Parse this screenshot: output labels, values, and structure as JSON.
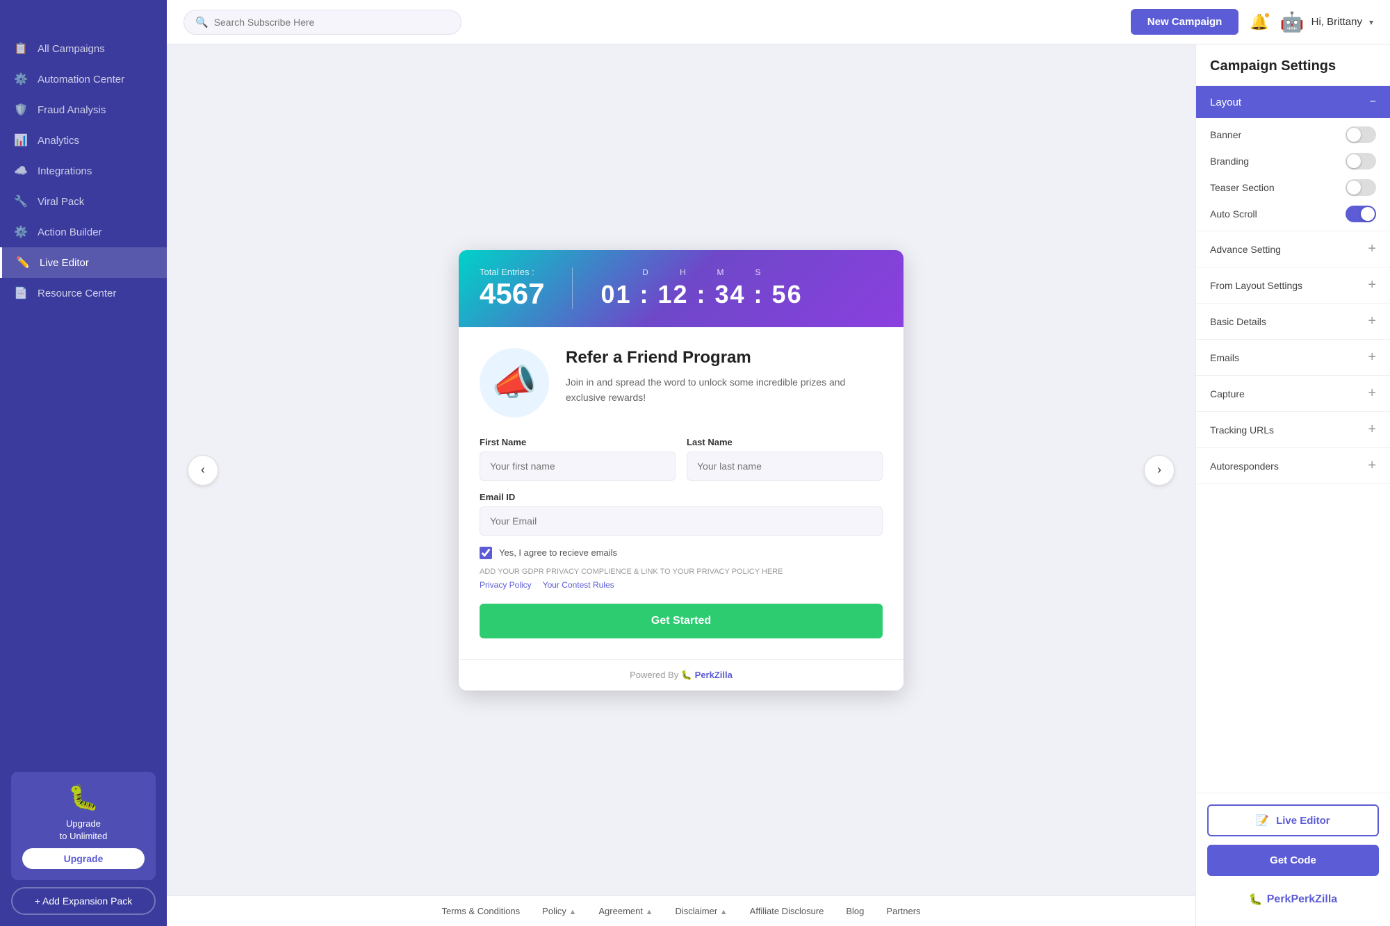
{
  "sidebar": {
    "items": [
      {
        "id": "all-campaigns",
        "label": "All Campaigns",
        "icon": "📋",
        "active": false
      },
      {
        "id": "automation-center",
        "label": "Automation Center",
        "icon": "⚙️",
        "active": false
      },
      {
        "id": "fraud-analysis",
        "label": "Fraud Analysis",
        "icon": "🛡️",
        "active": false
      },
      {
        "id": "analytics",
        "label": "Analytics",
        "icon": "📊",
        "active": false
      },
      {
        "id": "integrations",
        "label": "Integrations",
        "icon": "☁️",
        "active": false
      },
      {
        "id": "viral-pack",
        "label": "Viral Pack",
        "icon": "🔧",
        "active": false
      },
      {
        "id": "action-builder",
        "label": "Action Builder",
        "icon": "⚙️",
        "active": false
      },
      {
        "id": "live-editor",
        "label": "Live Editor",
        "icon": "✏️",
        "active": true
      },
      {
        "id": "resource-center",
        "label": "Resource Center",
        "icon": "📄",
        "active": false
      }
    ],
    "upgrade": {
      "text": "Upgrade\nto Unlimited",
      "button_label": "Upgrade"
    },
    "add_expansion": "+ Add Expansion Pack"
  },
  "topbar": {
    "search_placeholder": "Search Subscribe Here",
    "new_campaign_label": "New Campaign",
    "user_name": "Hi, Brittany"
  },
  "campaign": {
    "total_entries_label": "Total Entries :",
    "total_entries_value": "4567",
    "countdown": {
      "d_label": "D",
      "h_label": "H",
      "m_label": "M",
      "s_label": "S",
      "time": "01 : 12 : 34 : 56"
    },
    "title": "Refer a Friend Program",
    "description": "Join in and spread the word to unlock some incredible prizes and exclusive rewards!",
    "form": {
      "first_name_label": "First Name",
      "first_name_placeholder": "Your first name",
      "last_name_label": "Last Name",
      "last_name_placeholder": "Your last name",
      "email_label": "Email ID",
      "email_placeholder": "Your Email",
      "checkbox_label": "Yes, I agree to recieve emails",
      "gdpr_text": "ADD YOUR GDPR PRIVACY COMPLIENCE & LINK TO YOUR PRIVACY POLICY HERE",
      "privacy_policy_link": "Privacy Policy",
      "contest_rules_link": "Your Contest Rules",
      "submit_button": "Get Started"
    },
    "powered_by": "Powered By",
    "brand": "PerkZilla"
  },
  "footer": {
    "links": [
      {
        "label": "Terms & Conditions"
      },
      {
        "label": "Policy",
        "has_arrow": true
      },
      {
        "label": "Agreement",
        "has_arrow": true
      },
      {
        "label": "Disclaimer",
        "has_arrow": true
      },
      {
        "label": "Affiliate Disclosure"
      },
      {
        "label": "Blog"
      },
      {
        "label": "Partners"
      }
    ]
  },
  "right_panel": {
    "title": "Campaign Settings",
    "layout_section": {
      "label": "Layout",
      "active": true
    },
    "toggles": [
      {
        "id": "banner",
        "label": "Banner",
        "on": false
      },
      {
        "id": "branding",
        "label": "Branding",
        "on": false
      },
      {
        "id": "teaser-section",
        "label": "Teaser Section",
        "on": false
      },
      {
        "id": "auto-scroll",
        "label": "Auto Scroll",
        "on": true
      }
    ],
    "collapsed_sections": [
      {
        "id": "advance-setting",
        "label": "Advance Setting"
      },
      {
        "id": "from-layout-settings",
        "label": "From Layout Settings"
      },
      {
        "id": "basic-details",
        "label": "Basic Details"
      },
      {
        "id": "emails",
        "label": "Emails"
      },
      {
        "id": "capture",
        "label": "Capture"
      },
      {
        "id": "tracking-urls",
        "label": "Tracking URLs"
      },
      {
        "id": "autoresponders",
        "label": "Autoresponders"
      }
    ],
    "live_editor_label": "Live Editor",
    "get_code_label": "Get Code",
    "brand_name": "PerkZilla"
  }
}
